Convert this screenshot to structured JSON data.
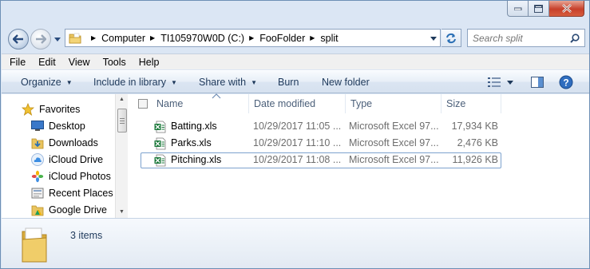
{
  "colors": {
    "accent": "#1e395b",
    "close_red": "#c7402a",
    "excel_green": "#1d7a3c"
  },
  "caption": {
    "minimize_icon": "minimize-icon",
    "maximize_icon": "maximize-icon",
    "close_icon": "close-x-icon"
  },
  "address": {
    "breadcrumbs": [
      "Computer",
      "TI105970W0D (C:)",
      "FooFolder",
      "split"
    ],
    "search_placeholder": "Search split"
  },
  "menu": [
    "File",
    "Edit",
    "View",
    "Tools",
    "Help"
  ],
  "toolbar": {
    "organize": "Organize",
    "include_in_library": "Include in library",
    "share_with": "Share with",
    "burn": "Burn",
    "new_folder": "New folder"
  },
  "nav": {
    "favorites_label": "Favorites",
    "items": [
      {
        "label": "Desktop",
        "icon": "desktop-icon"
      },
      {
        "label": "Downloads",
        "icon": "downloads-icon"
      },
      {
        "label": "iCloud Drive",
        "icon": "icloud-icon"
      },
      {
        "label": "iCloud Photos",
        "icon": "photos-icon"
      },
      {
        "label": "Recent Places",
        "icon": "recent-places-icon"
      },
      {
        "label": "Google Drive",
        "icon": "google-drive-icon"
      }
    ]
  },
  "columns": {
    "name": "Name",
    "date": "Date modified",
    "type": "Type",
    "size": "Size"
  },
  "files": [
    {
      "name": "Batting.xls",
      "date": "10/29/2017 11:05 ...",
      "type": "Microsoft Excel 97...",
      "size": "17,934 KB"
    },
    {
      "name": "Parks.xls",
      "date": "10/29/2017 11:10 ...",
      "type": "Microsoft Excel 97...",
      "size": "2,476 KB"
    },
    {
      "name": "Pitching.xls",
      "date": "10/29/2017 11:08 ...",
      "type": "Microsoft Excel 97...",
      "size": "11,926 KB"
    }
  ],
  "details": {
    "item_count": "3 items"
  }
}
